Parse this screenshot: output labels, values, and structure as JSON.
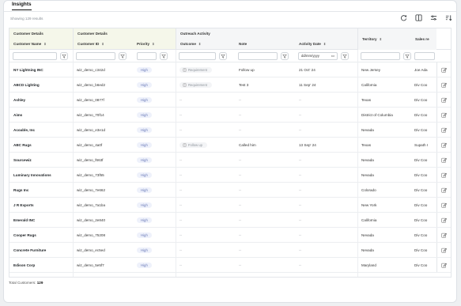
{
  "tab": "Insights",
  "results_text": "Showing 129 results",
  "toolbar_icons": [
    "refresh-icon",
    "columns-icon",
    "filter-lines-icon",
    "sort-icon"
  ],
  "column_groups": {
    "customer_details_a": "Customer Details",
    "customer_details_b": "Customer Details",
    "outreach_activity": "Outreach Activity"
  },
  "columns": {
    "customer_name": "Customer Name",
    "customer_id": "Customer ID",
    "priority": "Priority",
    "outcome": "Outcome",
    "note": "Note",
    "activity_date": "Activity Date",
    "territory": "Territory",
    "sales_rep": "Sales re"
  },
  "filters": {
    "date_placeholder": "dd/mm/yyyy"
  },
  "rows": [
    {
      "name": "NY Lightning INC",
      "id": "wiz_demo_c342d",
      "priority": "High",
      "outcome": "Requirement",
      "note": "Follow up",
      "date": "21 Oct' 24",
      "territory": "New Jersey",
      "rep": "Joe Ada"
    },
    {
      "name": "ABCD Lighting",
      "id": "wiz_demo_b6ed2",
      "priority": "High",
      "outcome": "Requirement",
      "note": "Test 3",
      "date": "11 Sep' 24",
      "territory": "California",
      "rep": "Div Coo"
    },
    {
      "name": "Ashley",
      "id": "wiz_demo_0877f",
      "priority": "High",
      "outcome": "--",
      "note": "--",
      "date": "--",
      "territory": "Texas",
      "rep": "Div Coo"
    },
    {
      "name": "Aims",
      "id": "wiz_demo_70f14",
      "priority": "High",
      "outcome": "--",
      "note": "--",
      "date": "--",
      "territory": "District of Columbia",
      "rep": "Div Coo"
    },
    {
      "name": "Acoable, Inc",
      "id": "wiz_demo_e3e1d",
      "priority": "High",
      "outcome": "--",
      "note": "--",
      "date": "--",
      "territory": "Nevada",
      "rep": "Div Coo"
    },
    {
      "name": "ABC Rugs",
      "id": "wiz_demo_4a0f",
      "priority": "High",
      "outcome": "Follow up",
      "note": "Called him",
      "date": "13 Sep' 24",
      "territory": "Texas",
      "rep": "Supath I"
    },
    {
      "name": "Sourcewiz",
      "id": "wiz_demo_f663f",
      "priority": "High",
      "outcome": "--",
      "note": "--",
      "date": "--",
      "territory": "Nevada",
      "rep": "Div Coo"
    },
    {
      "name": "Luminary Innovations",
      "id": "wiz_demo_73f55",
      "priority": "High",
      "outcome": "--",
      "note": "--",
      "date": "--",
      "territory": "Nevada",
      "rep": "Div Coo"
    },
    {
      "name": "Rugs Inc",
      "id": "wiz_demo_7e662",
      "priority": "High",
      "outcome": "--",
      "note": "--",
      "date": "--",
      "territory": "Colorado",
      "rep": "Div Coo"
    },
    {
      "name": "J R Exports",
      "id": "wiz_demo_7a1ba",
      "priority": "High",
      "outcome": "--",
      "note": "--",
      "date": "--",
      "territory": "New York",
      "rep": "Div Coo"
    },
    {
      "name": "Emerald INC",
      "id": "wiz_demo_2e840",
      "priority": "High",
      "outcome": "--",
      "note": "--",
      "date": "--",
      "territory": "California",
      "rep": "Div Coo"
    },
    {
      "name": "Cooper Rugs",
      "id": "wiz_demo_75208",
      "priority": "High",
      "outcome": "--",
      "note": "--",
      "date": "--",
      "territory": "Nevada",
      "rep": "Div Coo"
    },
    {
      "name": "Concrete Furniture",
      "id": "wiz_demo_ec5ed",
      "priority": "High",
      "outcome": "--",
      "note": "--",
      "date": "--",
      "territory": "Nevada",
      "rep": "Div Coo"
    },
    {
      "name": "Edison Corp",
      "id": "wiz_demo_5e5f7",
      "priority": "High",
      "outcome": "--",
      "note": "--",
      "date": "--",
      "territory": "Maryland",
      "rep": "Div Coo"
    }
  ],
  "footer": {
    "label": "Total Customers:",
    "count": "129"
  }
}
